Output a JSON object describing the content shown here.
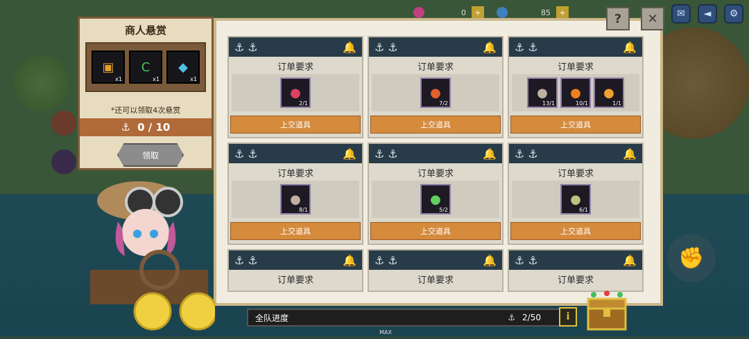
{
  "topbar": {
    "res1": "0",
    "res2": "85",
    "plus": "+"
  },
  "merchant": {
    "title": "商人悬赏",
    "rewards": [
      {
        "icon": "chest-icon",
        "count": "x1",
        "color": "#e0a030"
      },
      {
        "icon": "card-icon",
        "count": "x1",
        "color": "#50c060"
      },
      {
        "icon": "gem-icon",
        "count": "x1",
        "color": "#50c0e0"
      }
    ],
    "note": "*还可以领取4次悬赏",
    "progress": "0 / 10",
    "claim_label": "领取"
  },
  "cards": [
    {
      "title": "订单要求",
      "submit": "上交道具",
      "items": [
        {
          "icon": "crystal-icon",
          "count": "2/1",
          "color": "#e04060"
        }
      ]
    },
    {
      "title": "订单要求",
      "submit": "上交道具",
      "items": [
        {
          "icon": "carrot-icon",
          "count": "7/2",
          "color": "#e06030"
        }
      ]
    },
    {
      "title": "订单要求",
      "submit": "上交道具",
      "items": [
        {
          "icon": "fish-icon",
          "count": "13/1",
          "color": "#c0b0a0"
        },
        {
          "icon": "goldfish-icon",
          "count": "10/1",
          "color": "#f08020"
        },
        {
          "icon": "goldfish-icon",
          "count": "1/1",
          "color": "#f0a030"
        }
      ]
    },
    {
      "title": "订单要求",
      "submit": "上交道具",
      "items": [
        {
          "icon": "fish-icon",
          "count": "8/1",
          "color": "#c0b0a0"
        }
      ]
    },
    {
      "title": "订单要求",
      "submit": "上交道具",
      "items": [
        {
          "icon": "cabbage-icon",
          "count": "5/2",
          "color": "#60d060"
        }
      ]
    },
    {
      "title": "订单要求",
      "submit": "上交道具",
      "items": [
        {
          "icon": "pufferfish-icon",
          "count": "6/1",
          "color": "#c0c080"
        }
      ]
    },
    {
      "title": "订单要求",
      "submit": "",
      "items": []
    },
    {
      "title": "订单要求",
      "submit": "",
      "items": []
    },
    {
      "title": "订单要求",
      "submit": "",
      "items": []
    }
  ],
  "team": {
    "label": "全队进度",
    "value": "2/50",
    "info": "i"
  },
  "bottom": {
    "max": "MAX"
  }
}
